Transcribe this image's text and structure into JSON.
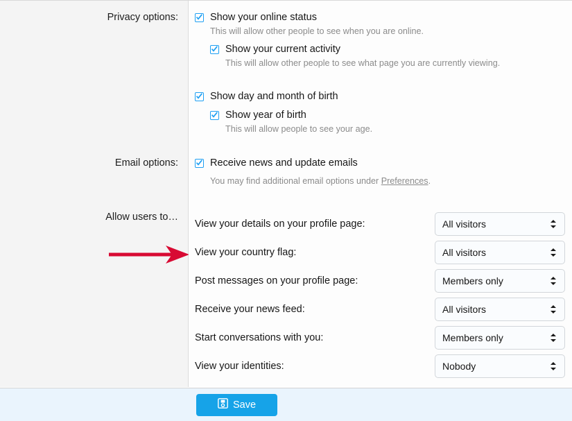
{
  "sidebar": {
    "labels": [
      {
        "id": "privacy",
        "text": "Privacy options:"
      },
      {
        "id": "email",
        "text": "Email options:"
      },
      {
        "id": "allow",
        "text": "Allow users to…"
      }
    ]
  },
  "privacy_options": {
    "checkboxes": [
      {
        "label": "Show your online status",
        "checked": true,
        "level": 1,
        "hint": "This will allow other people to see when you are online."
      },
      {
        "label": "Show your current activity",
        "checked": true,
        "level": 2,
        "hint": "This will allow other people to see what page you are currently viewing."
      },
      {
        "label": "Show day and month of birth",
        "checked": true,
        "level": 1,
        "hint": ""
      },
      {
        "label": "Show year of birth",
        "checked": true,
        "level": 2,
        "hint": "This will allow people to see your age."
      }
    ]
  },
  "email_options": {
    "checkbox": {
      "label": "Receive news and update emails",
      "checked": true
    },
    "hint_before": "You may find additional email options under ",
    "hint_link": "Preferences",
    "hint_after": "."
  },
  "allow_users_to": {
    "rows": [
      {
        "label": "View your details on your profile page:",
        "value": "All visitors"
      },
      {
        "label": "View your country flag:",
        "value": "All visitors"
      },
      {
        "label": "Post messages on your profile page:",
        "value": "Members only"
      },
      {
        "label": "Receive your news feed:",
        "value": "All visitors"
      },
      {
        "label": "Start conversations with you:",
        "value": "Members only"
      },
      {
        "label": "View your identities:",
        "value": "Nobody"
      }
    ]
  },
  "footer": {
    "save_label": "Save",
    "save_icon": "floppy-disk-save-icon"
  },
  "annotation": {
    "arrow_icon": "red-right-arrow-icon",
    "arrow_color": "#d80a33"
  },
  "colors": {
    "accent_blue": "#16a3e8",
    "checkbox_blue": "#1e9ff2",
    "sidebar_bg": "#f4f4f4",
    "footer_bg": "#eaf4fd",
    "hint_text": "#8b8b8b",
    "arrow_red": "#d80a33"
  }
}
